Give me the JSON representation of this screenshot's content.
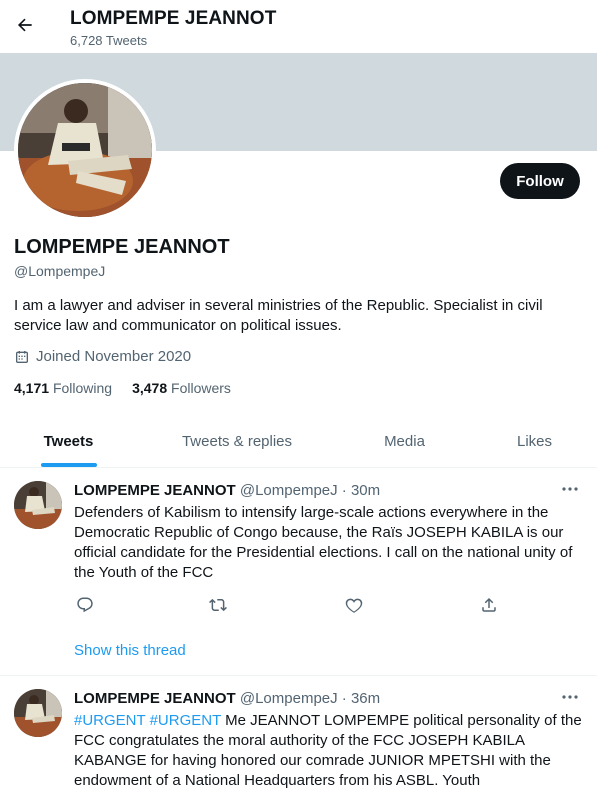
{
  "header": {
    "name": "LOMPEMPE JEANNOT",
    "tweet_count": "6,728 Tweets",
    "back_icon": "arrow-left-icon"
  },
  "profile": {
    "name": "LOMPEMPE JEANNOT",
    "handle": "@LompempeJ",
    "bio": "I am a lawyer and adviser in several ministries of the Republic. Specialist in civil service law and communicator on political issues.",
    "joined": "Joined November 2020",
    "following_count": "4,171",
    "following_label": "Following",
    "followers_count": "3,478",
    "followers_label": "Followers",
    "follow_label": "Follow",
    "banner_color": "#cfd9de"
  },
  "tabs": [
    {
      "label": "Tweets",
      "active": true
    },
    {
      "label": "Tweets & replies",
      "active": false
    },
    {
      "label": "Media",
      "active": false
    },
    {
      "label": "Likes",
      "active": false
    }
  ],
  "tweets": [
    {
      "name": "LOMPEMPE JEANNOT",
      "handle_time": "@LompempeJ · 30m",
      "text": "Defenders of Kabilism to intensify large-scale actions everywhere in the Democratic Republic of Congo because, the Raïs JOSEPH KABILA is our official candidate for the Presidential elections. I call on the national unity of the Youth of the FCC",
      "show_thread": "Show this thread"
    },
    {
      "name": "LOMPEMPE JEANNOT",
      "handle_time": "@LompempeJ · 36m",
      "hashtag1": "#URGENT",
      "hashtag2": "#URGENT",
      "text": " Me JEANNOT LOMPEMPE political personality of the FCC congratulates the moral authority of the FCC JOSEPH KABILA KABANGE for having honored our comrade JUNIOR MPETSHI with the endowment of a National Headquarters from his ASBL. Youth"
    }
  ],
  "colors": {
    "accent": "#1d9bf0",
    "text": "#0f1419",
    "muted": "#536471",
    "border": "#eff3f4"
  }
}
